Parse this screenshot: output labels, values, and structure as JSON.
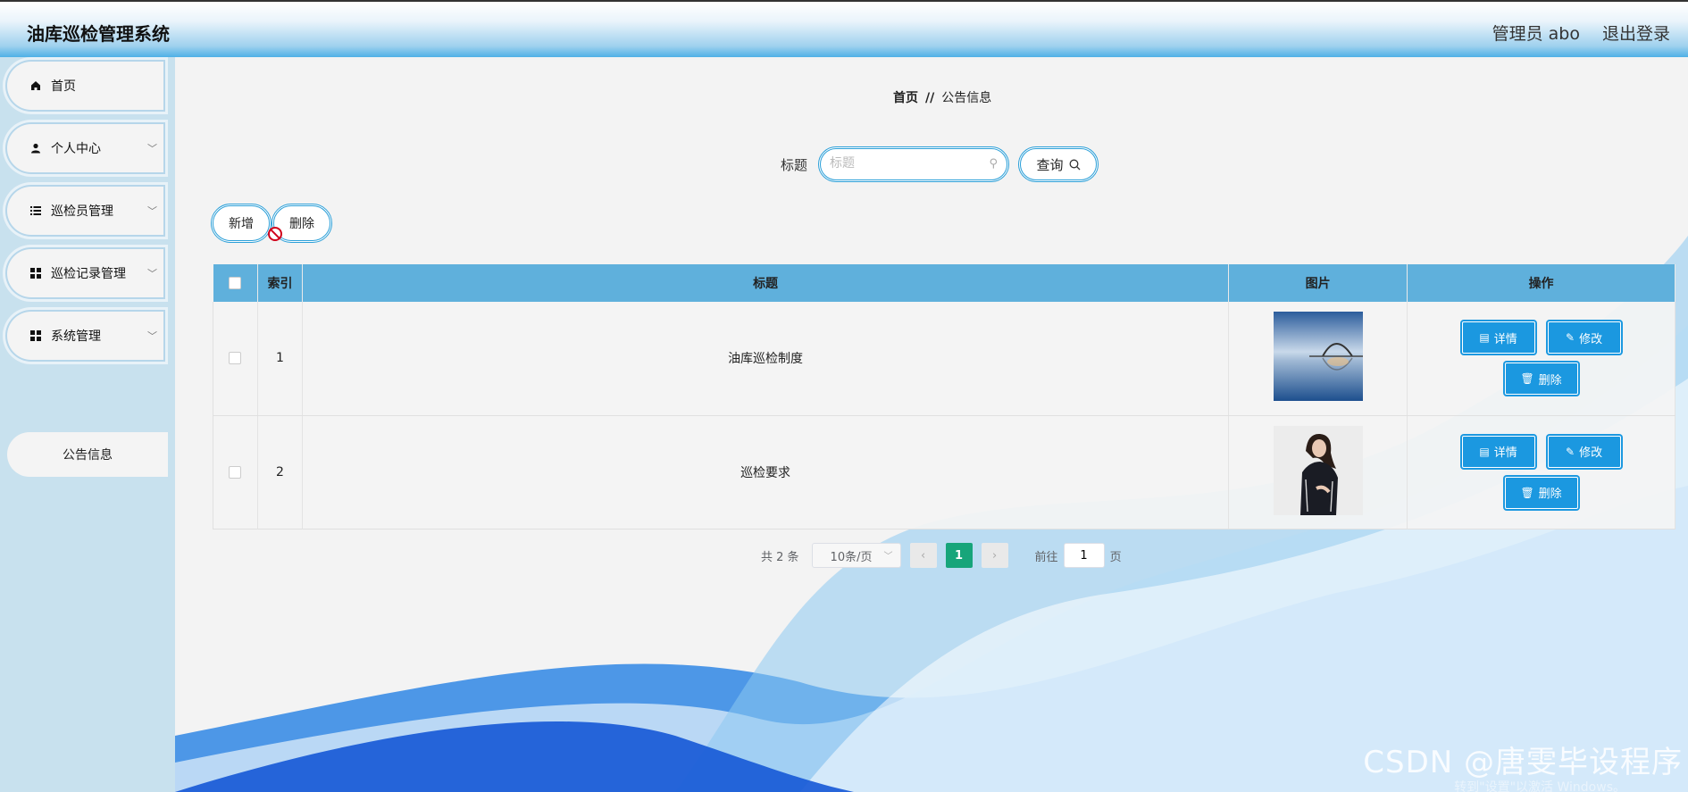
{
  "header": {
    "title": "油库巡检管理系统",
    "user_label": "管理员 abo",
    "logout_label": "退出登录"
  },
  "sidebar": {
    "items": [
      {
        "label": "首页",
        "icon": "home-icon"
      },
      {
        "label": "个人中心",
        "icon": "user-icon"
      },
      {
        "label": "巡检员管理",
        "icon": "list-icon"
      },
      {
        "label": "巡检记录管理",
        "icon": "grid-icon"
      },
      {
        "label": "系统管理",
        "icon": "grid-icon"
      }
    ],
    "sub_item": "公告信息"
  },
  "breadcrumb": {
    "home": "首页",
    "separator": "//",
    "current": "公告信息"
  },
  "search": {
    "label": "标题",
    "placeholder": "标题",
    "query_label": "查询"
  },
  "toolbar": {
    "add_label": "新增",
    "delete_label": "删除"
  },
  "table": {
    "headers": {
      "index": "索引",
      "title": "标题",
      "image": "图片",
      "actions": "操作"
    },
    "rows": [
      {
        "index": "1",
        "title": "油库巡检制度"
      },
      {
        "index": "2",
        "title": "巡检要求"
      }
    ],
    "actions": {
      "detail": "详情",
      "edit": "修改",
      "delete": "删除"
    }
  },
  "pagination": {
    "total": "共 2 条",
    "page_size": "10条/页",
    "current_page": "1",
    "goto_label": "前往",
    "goto_value": "1",
    "page_suffix": "页"
  },
  "watermark": "CSDN @唐雯毕设程序",
  "activation_text": "转到\"设置\"以激活 Windows。",
  "colors": {
    "accent": "#1b98e0",
    "header_gradient_end": "#4fb0e6",
    "table_header": "#5fb0dc",
    "page_active": "#17a57a",
    "sidebar_bg": "#c8e1ee"
  }
}
